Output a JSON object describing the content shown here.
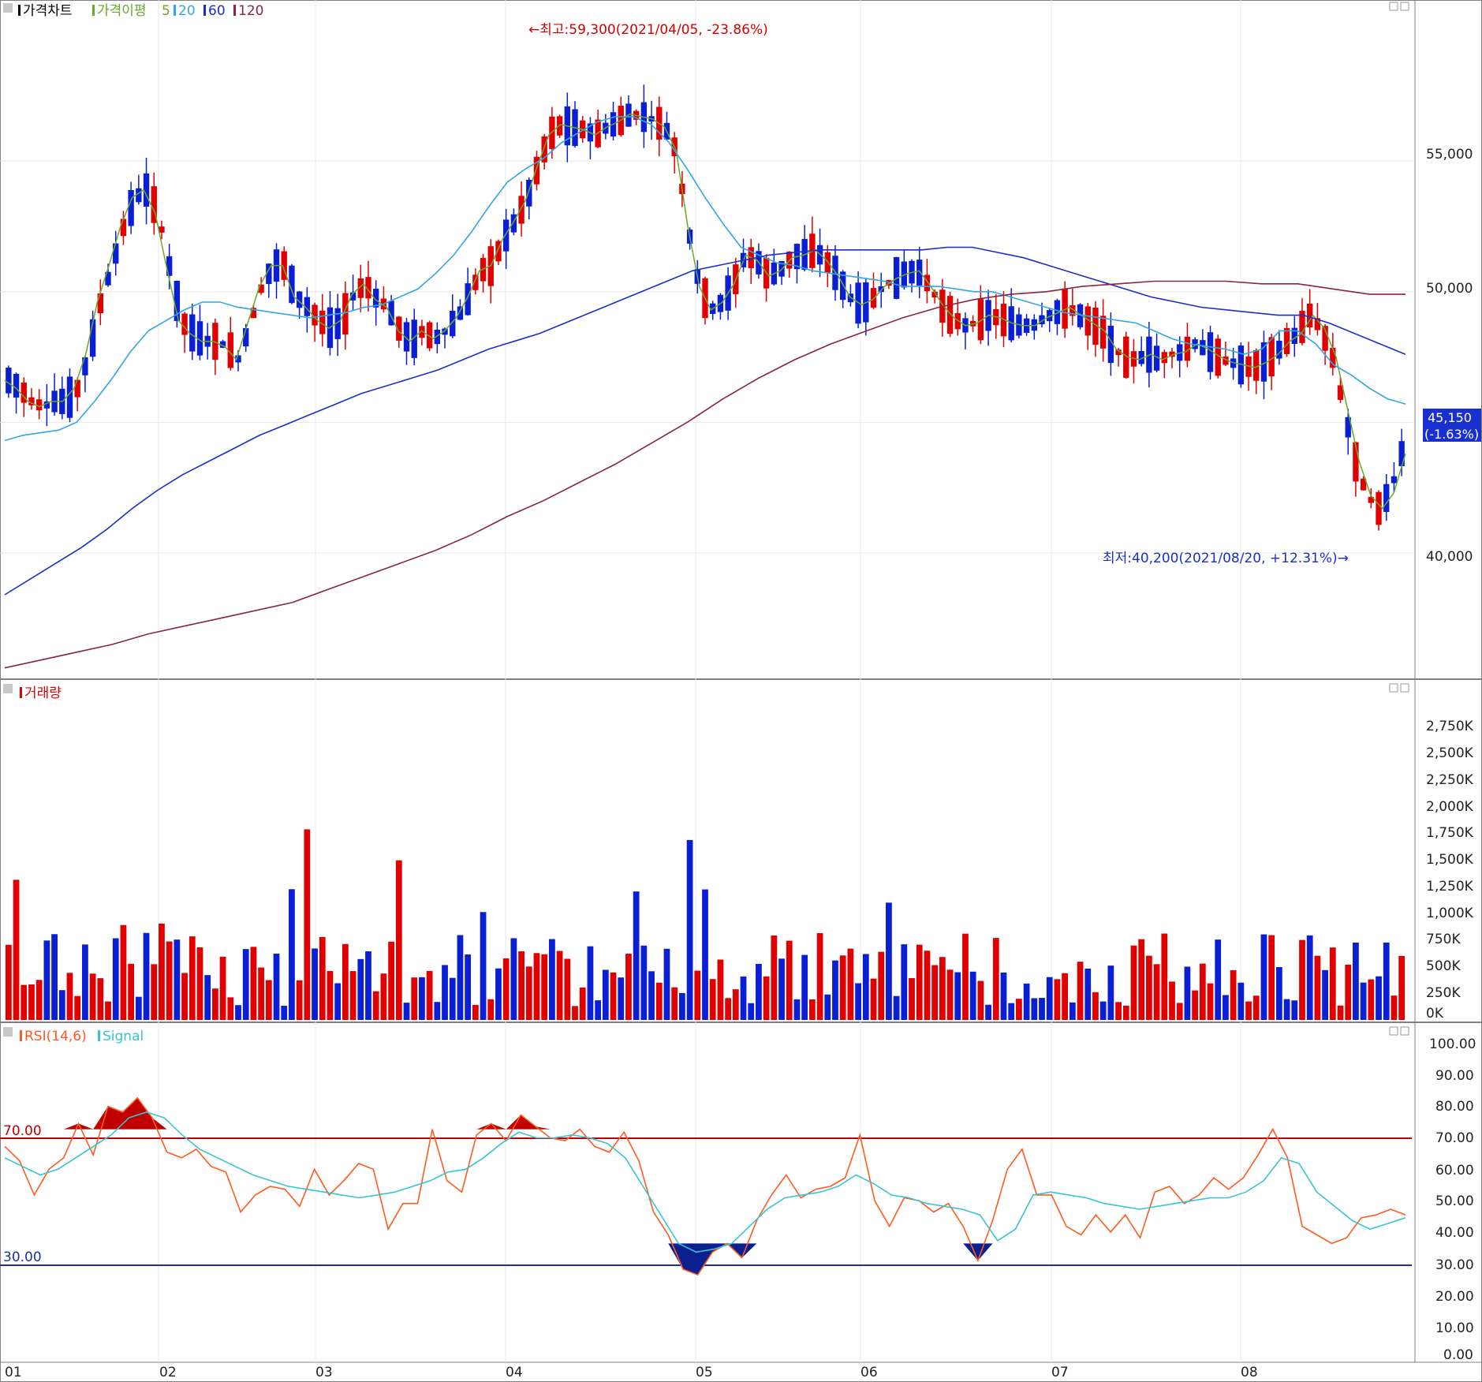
{
  "colors": {
    "up": "#e00000",
    "down": "#0a1fd4",
    "ma5": "#6aa82a",
    "ma20": "#35a6e0",
    "ma60": "#1a2fc8",
    "ma120": "#8a2440",
    "grid": "#e8e8e8",
    "rsi": "#ff5a1f",
    "signal": "#38c5d0",
    "rsi_high_line": "#c00000",
    "rsi_low_line": "#1b2f9e",
    "price_tag_bg": "#1a2fd0"
  },
  "price_panel": {
    "legend": {
      "label": "가격차트",
      "ma_label": "가격이평",
      "ma5": "5",
      "ma20": "20",
      "ma60": "60",
      "ma120": "120"
    },
    "y_ticks": [
      "55,000",
      "50,000",
      "40,000"
    ],
    "high_annotation": "←최고:59,300(2021/04/05, -23.86%)",
    "low_annotation": "최저:40,200(2021/08/20, +12.31%)→",
    "current_price": "45,150",
    "current_change": "(-1.63%)"
  },
  "volume_panel": {
    "legend": "거래량",
    "y_ticks": [
      "2,750K",
      "2,500K",
      "2,250K",
      "2,000K",
      "1,750K",
      "1,500K",
      "1,250K",
      "1,000K",
      "750K",
      "500K",
      "250K",
      "0K"
    ]
  },
  "rsi_panel": {
    "legend_rsi": "RSI(14,6)",
    "legend_signal": "Signal",
    "high_label": "70.00",
    "low_label": "30.00",
    "y_ticks": [
      "100.00",
      "90.00",
      "80.00",
      "70.00",
      "60.00",
      "50.00",
      "40.00",
      "30.00",
      "20.00",
      "10.00",
      "0.00"
    ]
  },
  "x_labels": [
    "01",
    "02",
    "03",
    "04",
    "05",
    "06",
    "07",
    "08"
  ],
  "chart_data": [
    {
      "type": "candlestick",
      "title": "가격차트",
      "ylim": [
        35500,
        60500
      ],
      "bar_count": 183,
      "x_tick_labels": [
        "01",
        "02",
        "03",
        "04",
        "05",
        "06",
        "07",
        "08"
      ],
      "series": [
        {
          "name": "5",
          "values": [
            46600,
            46300,
            45800,
            45600,
            45800,
            45800,
            46300,
            47600,
            49600,
            51000,
            52500,
            53600,
            53900,
            53000,
            50900,
            48900,
            48400,
            48100,
            48100,
            47900,
            47400,
            48800,
            50200,
            51000,
            51000,
            49800,
            49400,
            48900,
            48600,
            48900,
            49900,
            50300,
            49700,
            49400,
            48500,
            48100,
            48500,
            48200,
            48500,
            49000,
            49800,
            50800,
            51000,
            52000,
            52700,
            53500,
            54800,
            56000,
            56400,
            56300,
            56200,
            56000,
            56300,
            56500,
            56800,
            56700,
            56600,
            56300,
            55400,
            52500,
            50200,
            49300,
            49600,
            50300,
            51400,
            51200,
            50600,
            50800,
            51300,
            51400,
            51600,
            51200,
            50600,
            49800,
            49500,
            49700,
            50200,
            50500,
            50700,
            50800,
            50200,
            49500,
            49000,
            48700,
            48800,
            49100,
            49000,
            48800,
            48700,
            48700,
            49000,
            49200,
            49400,
            49100,
            48800,
            48500,
            47800,
            47500,
            47400,
            47600,
            47400,
            47600,
            47700,
            48000,
            47800,
            47500,
            47300,
            47200,
            47100,
            47300,
            47600,
            48100,
            48400,
            49100,
            48600,
            47500,
            45500,
            43500,
            42200,
            41700,
            42300,
            43800
          ]
        },
        {
          "name": "20",
          "values": [
            44300,
            44500,
            44600,
            44700,
            45000,
            45800,
            46700,
            47700,
            48500,
            48900,
            49300,
            49600,
            49600,
            49400,
            49300,
            49200,
            49100,
            49000,
            49100,
            49200,
            49400,
            49500,
            49800,
            50100,
            50700,
            51400,
            52300,
            53300,
            54200,
            54700,
            55100,
            55700,
            56100,
            56500,
            56700,
            56700,
            56400,
            55700,
            54700,
            53600,
            52600,
            51700,
            51400,
            51100,
            51000,
            50800,
            50700,
            50600,
            50500,
            50400,
            50200,
            50200,
            50200,
            50100,
            50000,
            50000,
            49800,
            49600,
            49400,
            49200,
            49100,
            49000,
            48900,
            48800,
            48500,
            48200,
            48000,
            47900,
            47800,
            47600,
            47800,
            48500,
            48500,
            48000,
            47200,
            46800,
            46300,
            45900,
            45700
          ]
        },
        {
          "name": "60",
          "values": [
            38400,
            39000,
            39600,
            40200,
            40900,
            41700,
            42400,
            43000,
            43500,
            44000,
            44500,
            44900,
            45300,
            45700,
            46100,
            46400,
            46700,
            47000,
            47400,
            47800,
            48100,
            48400,
            48800,
            49200,
            49600,
            50000,
            50400,
            50800,
            51000,
            51200,
            51400,
            51500,
            51600,
            51600,
            51600,
            51600,
            51600,
            51700,
            51700,
            51500,
            51300,
            51000,
            50700,
            50400,
            50100,
            49800,
            49600,
            49400,
            49300,
            49200,
            49100,
            49100,
            48800,
            48400,
            48000,
            47600
          ]
        },
        {
          "name": "120",
          "values": [
            35600,
            35900,
            36200,
            36500,
            36900,
            37200,
            37500,
            37800,
            38100,
            38600,
            39100,
            39600,
            40100,
            40700,
            41400,
            42000,
            42700,
            43400,
            44200,
            45000,
            45900,
            46700,
            47400,
            48000,
            48500,
            49000,
            49400,
            49700,
            49900,
            50000,
            50200,
            50300,
            50400,
            50400,
            50400,
            50300,
            50300,
            50100,
            49900,
            49900
          ]
        }
      ]
    },
    {
      "type": "bar",
      "title": "거래량",
      "ylim": [
        0,
        2980
      ],
      "unit": "K",
      "approx_bar_count": 183
    },
    {
      "type": "line",
      "title": "RSI(14,6)",
      "ylim": [
        0,
        100
      ],
      "reference_lines": [
        70,
        30
      ],
      "series": [
        {
          "name": "RSI(14,6)",
          "values": [
            64,
            59,
            47,
            56,
            60,
            72,
            61,
            78,
            76,
            81,
            74,
            62,
            60,
            63,
            57,
            55,
            41,
            47,
            50,
            49,
            43,
            56,
            47,
            52,
            58,
            56,
            35,
            44,
            44,
            70,
            52,
            48,
            68,
            72,
            66,
            75,
            71,
            67,
            66,
            70,
            64,
            62,
            69,
            59,
            41,
            33,
            21,
            19,
            27,
            30,
            25,
            38,
            47,
            54,
            46,
            49,
            50,
            53,
            68,
            45,
            36,
            46,
            45,
            41,
            44,
            36,
            24,
            38,
            56,
            63,
            47,
            47,
            36,
            33,
            40,
            34,
            40,
            32,
            48,
            50,
            44,
            47,
            53,
            49,
            53,
            61,
            70,
            60,
            36,
            33,
            30,
            32,
            39,
            40,
            42,
            40
          ]
        },
        {
          "name": "Signal",
          "values": [
            60,
            57,
            54,
            56,
            60,
            64,
            68,
            74,
            76,
            74,
            68,
            63,
            60,
            57,
            54,
            52,
            50,
            49,
            48,
            47,
            46,
            47,
            48,
            50,
            52,
            55,
            56,
            60,
            65,
            69,
            67,
            67,
            68,
            67,
            65,
            60,
            50,
            40,
            30,
            27,
            28,
            30,
            36,
            42,
            46,
            47,
            48,
            50,
            54,
            51,
            47,
            46,
            44,
            43,
            42,
            40,
            31,
            35,
            47,
            48,
            47,
            46,
            44,
            43,
            42,
            43,
            44,
            45,
            46,
            46,
            48,
            52,
            60,
            58,
            48,
            43,
            38,
            35,
            37,
            39
          ]
        }
      ]
    }
  ]
}
